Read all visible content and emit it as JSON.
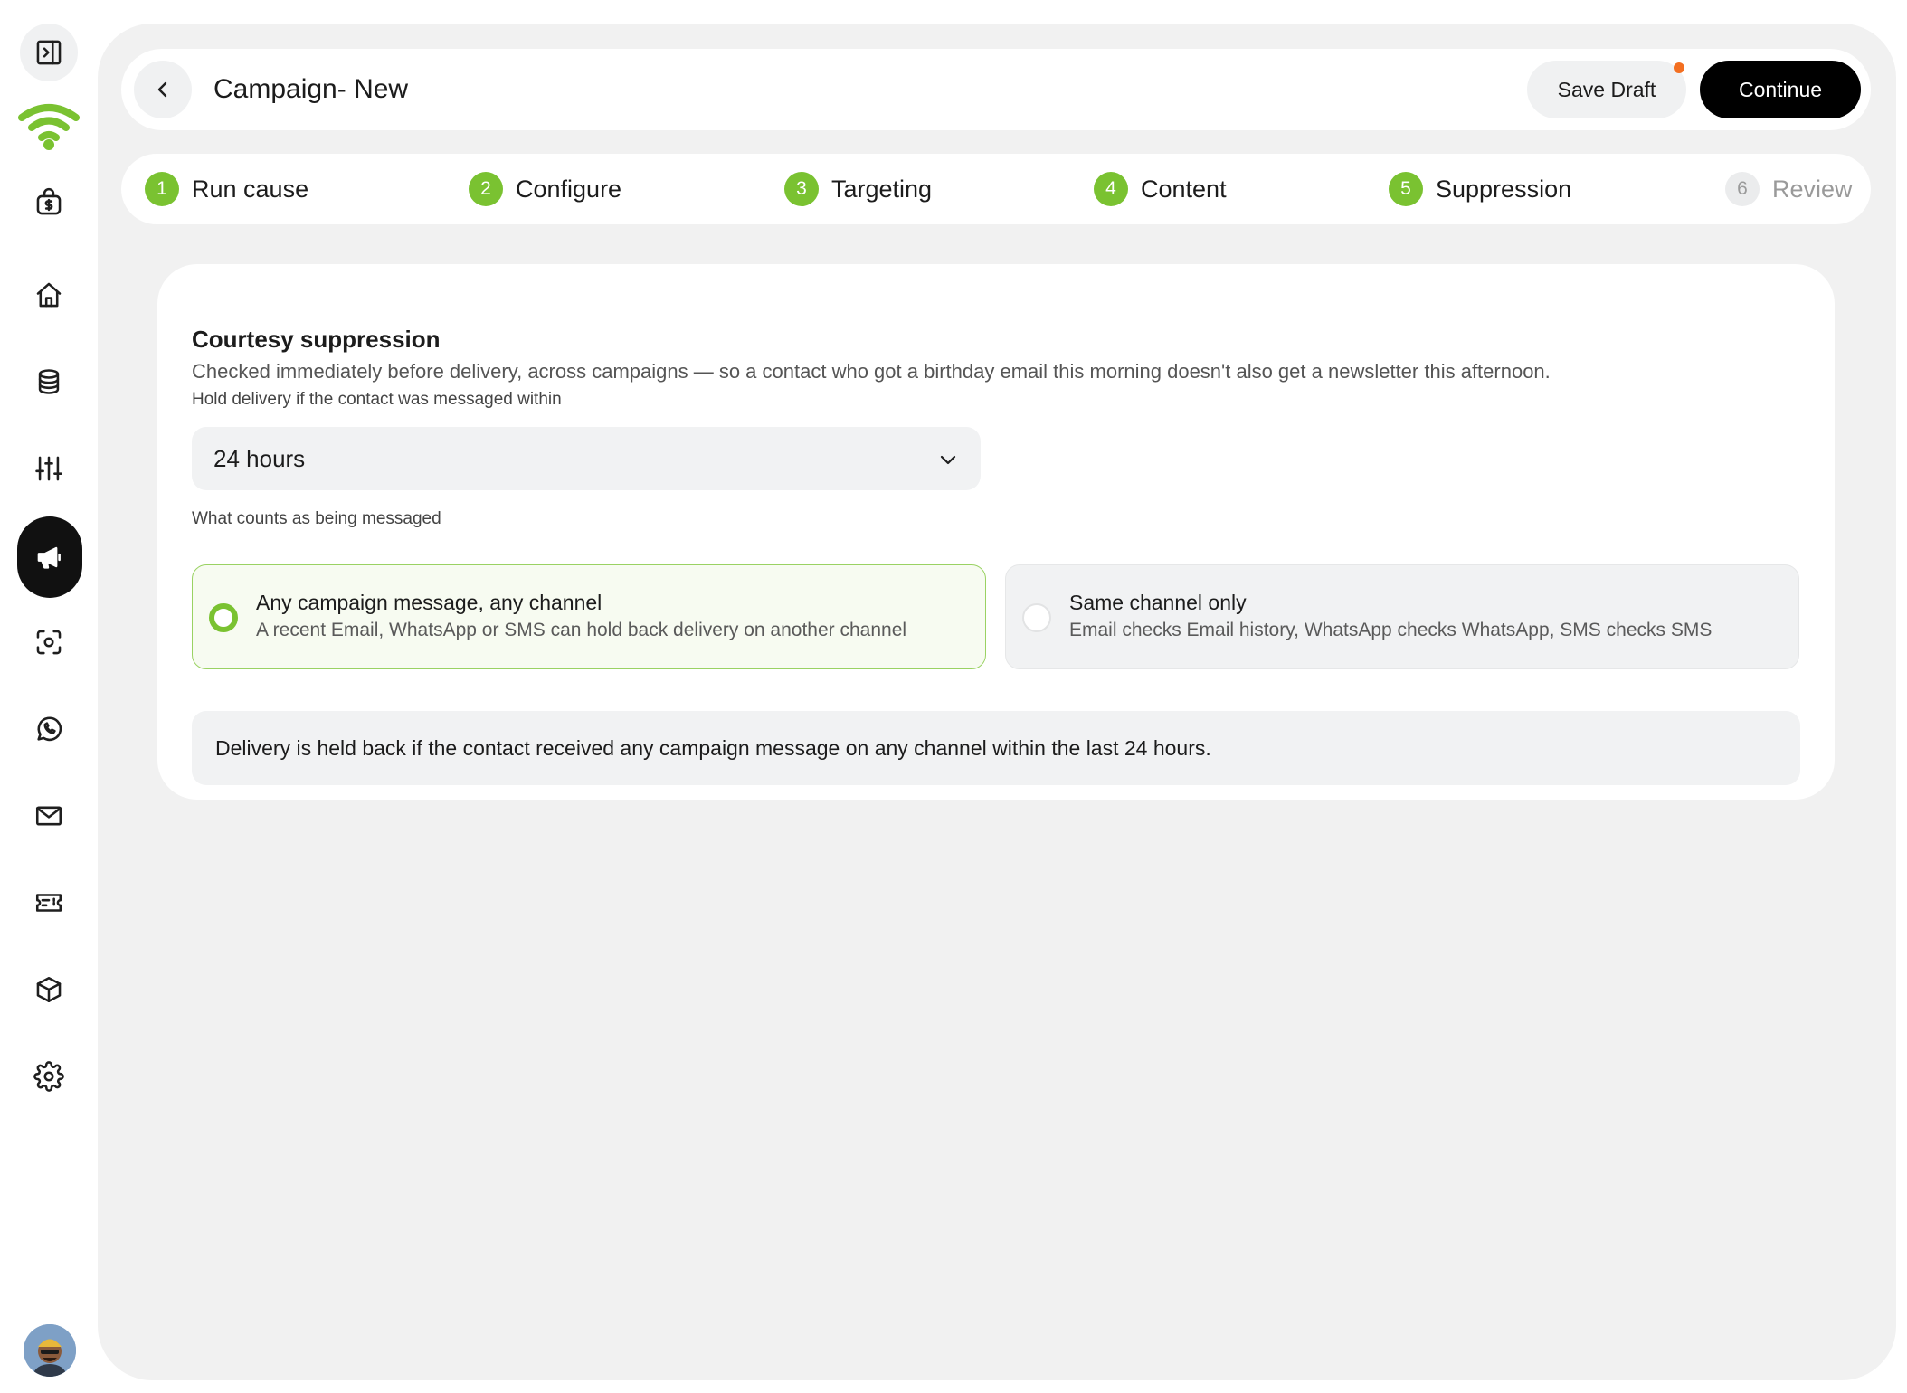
{
  "sidebar": {
    "items": [
      {
        "name": "toggle-panel-icon"
      },
      {
        "name": "wifi-logo-icon"
      },
      {
        "name": "money-bag-icon"
      },
      {
        "name": "home-icon"
      },
      {
        "name": "database-icon"
      },
      {
        "name": "sliders-icon"
      },
      {
        "name": "megaphone-icon",
        "active": true
      },
      {
        "name": "scan-icon"
      },
      {
        "name": "whatsapp-icon"
      },
      {
        "name": "mail-icon"
      },
      {
        "name": "ticket-icon"
      },
      {
        "name": "box-icon"
      },
      {
        "name": "settings-icon"
      }
    ],
    "accent_color": "#7ac231"
  },
  "header": {
    "title": "Campaign- New",
    "save_draft_label": "Save Draft",
    "continue_label": "Continue",
    "draft_indicator_color": "#f36f21"
  },
  "steps": [
    {
      "num": "1",
      "label": "Run cause",
      "status": "complete"
    },
    {
      "num": "2",
      "label": "Configure",
      "status": "complete"
    },
    {
      "num": "3",
      "label": "Targeting",
      "status": "complete"
    },
    {
      "num": "4",
      "label": "Content",
      "status": "complete"
    },
    {
      "num": "5",
      "label": "Suppression",
      "status": "current"
    },
    {
      "num": "6",
      "label": "Review",
      "status": "pending"
    }
  ],
  "card": {
    "title": "Courtesy suppression",
    "description": "Checked immediately before delivery, across campaigns — so a contact who got a birthday email this morning doesn't also get a newsletter this afternoon.",
    "hold_label": "Hold delivery if the contact was messaged within",
    "hold_value": "24 hours",
    "counts_label": "What counts as being messaged",
    "options": [
      {
        "title": "Any campaign message, any channel",
        "subtitle": "A recent Email, WhatsApp or SMS can hold back delivery on another channel",
        "selected": true
      },
      {
        "title": "Same channel only",
        "subtitle": "Email checks Email history, WhatsApp checks WhatsApp, SMS checks SMS",
        "selected": false
      }
    ],
    "summary": "Delivery is held back if the contact received any campaign message on any channel within the last 24 hours."
  }
}
